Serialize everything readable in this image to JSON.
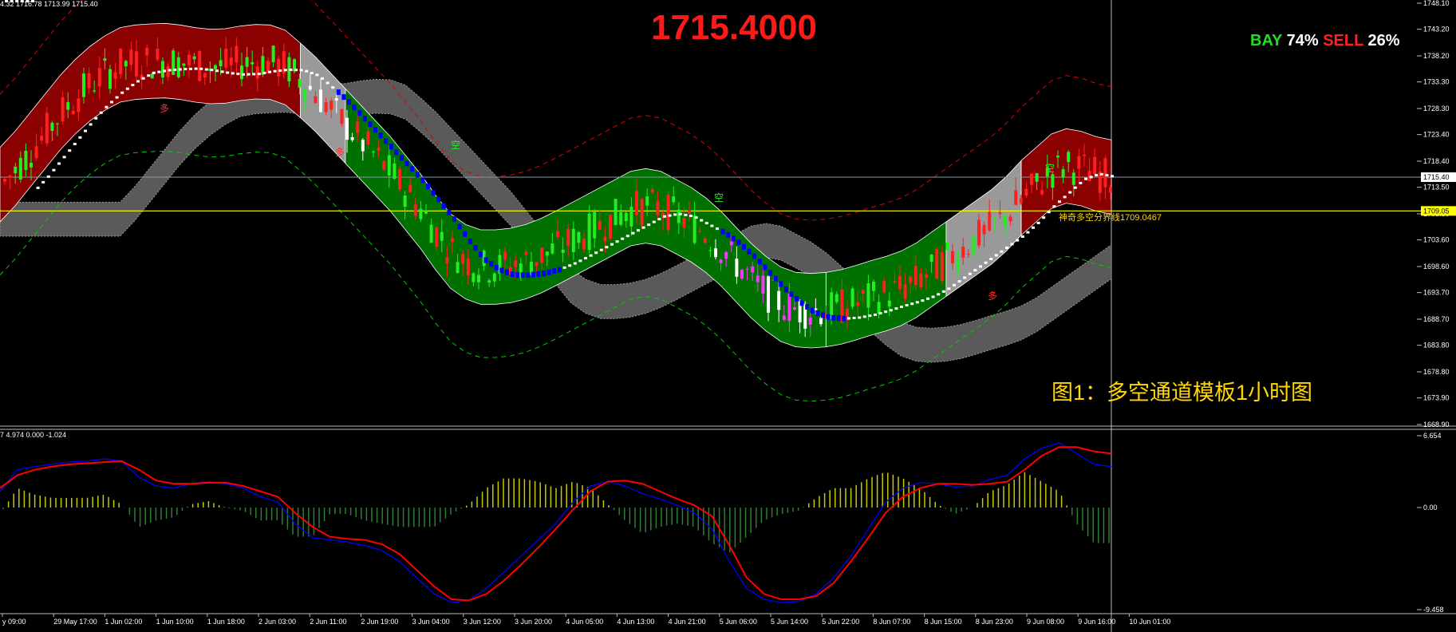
{
  "header": {
    "ohlc_text": "4.32 1716.78 1713.99 1715.40"
  },
  "macd_header": {
    "text": "7 4.974 0.000 -1.024"
  },
  "big_price": "1715.4000",
  "sentiment": {
    "bay_label": "BAY",
    "bay_value": "74%",
    "sell_label": "SELL",
    "sell_value": "26%"
  },
  "figure_title": "图1：多空通道模板1小时图",
  "boundary_label": "神奇多空分界线1709.0467",
  "colors": {
    "bull": "#00ff00",
    "bear": "#ff0000",
    "channel_bull": "#007000",
    "channel_bear": "#8b0000",
    "band_gray": "#5a5a5a",
    "bound_line": "#ffff00",
    "macd_main": "#0000ff",
    "macd_signal": "#ff0000"
  },
  "chart_data": [
    {
      "type": "line",
      "title": "",
      "ylim": [
        1668.9,
        1748.1
      ],
      "price_ticks": [
        "1748.10",
        "1743.20",
        "1738.20",
        "1733.30",
        "1728.30",
        "1723.40",
        "1718.40",
        "1713.50",
        "1708.50",
        "1703.60",
        "1698.60",
        "1693.70",
        "1688.70",
        "1683.80",
        "1678.80",
        "1673.90",
        "1668.90"
      ],
      "time_ticks": [
        "y 09:00",
        "29 May 17:00",
        "1 Jun 02:00",
        "1 Jun 10:00",
        "1 Jun 18:00",
        "2 Jun 03:00",
        "2 Jun 11:00",
        "2 Jun 19:00",
        "3 Jun 04:00",
        "3 Jun 12:00",
        "3 Jun 20:00",
        "4 Jun 05:00",
        "4 Jun 13:00",
        "4 Jun 21:00",
        "5 Jun 06:00",
        "5 Jun 14:00",
        "5 Jun 22:00",
        "8 Jun 07:00",
        "8 Jun 15:00",
        "8 Jun 23:00",
        "9 Jun 08:00",
        "9 Jun 16:00",
        "10 Jun 01:00"
      ],
      "markers": {
        "current_price": "1715.40",
        "boundary": "1709.05"
      },
      "series": [
        {
          "values": [
            1714.0,
            1717.0,
            1720.5,
            1724.0,
            1727.5,
            1730.5,
            1733.0,
            1735.0,
            1736.5,
            1737.0,
            1737.2,
            1737.3,
            1737.0,
            1736.5,
            1736.2,
            1736.3,
            1736.8,
            1737.1,
            1737.0,
            1736.0,
            1733.6,
            1731.0,
            1728.0,
            1725.0,
            1722.0,
            1719.0,
            1716.0,
            1712.5,
            1709.0,
            1705.0,
            1701.5,
            1699.5,
            1698.5,
            1698.5,
            1698.8,
            1699.5,
            1700.6,
            1702.0,
            1703.5,
            1705.0,
            1706.5,
            1708.0,
            1709.5,
            1710.0,
            1709.5,
            1708.0,
            1706.5,
            1704.5,
            1702.0,
            1699.0,
            1696.0,
            1693.5,
            1691.5,
            1690.5,
            1690.3,
            1690.5,
            1691.0,
            1691.8,
            1692.7,
            1693.5,
            1694.5,
            1696.0,
            1698.0,
            1700.0,
            1702.0,
            1704.0,
            1706.0,
            1708.5,
            1711.5,
            1714.0,
            1716.5,
            1717.5,
            1717.0,
            1716.0,
            1715.4
          ],
          "name": ""
        }
      ],
      "candles": "generated"
    },
    {
      "type": "line",
      "ylim": [
        -9.458,
        6.654
      ],
      "ticks": [
        "6.654",
        "0.00",
        "-9.458"
      ],
      "series": [
        {
          "values": [
            1.5,
            3.5,
            3.8,
            4.0,
            4.2,
            4.3,
            4.5,
            4.3,
            2.8,
            2.0,
            1.8,
            2.2,
            2.4,
            2.2,
            1.8,
            1.0,
            0.5,
            -1.5,
            -2.8,
            -3.0,
            -3.2,
            -3.5,
            -4.0,
            -5.0,
            -6.5,
            -8.0,
            -8.8,
            -8.6,
            -7.5,
            -6.0,
            -4.5,
            -3.0,
            -1.5,
            0.5,
            2.0,
            2.4,
            2.0,
            1.3,
            0.8,
            0.2,
            -0.5,
            -2.0,
            -5.0,
            -7.5,
            -8.5,
            -8.8,
            -8.7,
            -8.0,
            -6.5,
            -4.5,
            -2.0,
            0.5,
            1.8,
            2.3,
            2.2,
            1.9,
            2.0,
            2.6,
            3.0,
            4.5,
            5.5,
            6.0,
            5.0,
            4.0,
            3.8
          ]
        },
        {
          "values": [
            1.8,
            3.0,
            3.5,
            3.8,
            4.0,
            4.1,
            4.2,
            4.3,
            3.5,
            2.5,
            2.2,
            2.2,
            2.3,
            2.3,
            2.0,
            1.5,
            1.0,
            -0.5,
            -1.8,
            -2.7,
            -2.9,
            -3.0,
            -3.4,
            -4.3,
            -5.8,
            -7.3,
            -8.5,
            -8.6,
            -8.0,
            -6.8,
            -5.3,
            -3.7,
            -2.0,
            -0.2,
            1.5,
            2.4,
            2.5,
            2.2,
            1.5,
            0.8,
            0.2,
            -0.8,
            -3.5,
            -6.5,
            -8.0,
            -8.5,
            -8.5,
            -8.2,
            -7.0,
            -5.0,
            -2.8,
            -0.5,
            1.0,
            1.8,
            2.2,
            2.2,
            2.1,
            2.2,
            2.4,
            3.5,
            4.8,
            5.6,
            5.6,
            5.2,
            5.0
          ]
        }
      ]
    }
  ]
}
